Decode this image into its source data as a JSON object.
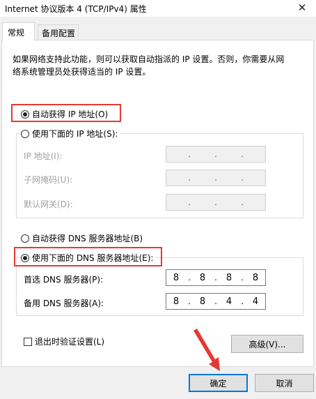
{
  "window": {
    "title": "Internet 协议版本 4 (TCP/IPv4) 属性",
    "close_icon": "close-icon"
  },
  "tabs": [
    {
      "label": "常规",
      "active": true
    },
    {
      "label": "备用配置",
      "active": false
    }
  ],
  "description": "如果网络支持此功能，则可以获取自动指派的 IP 设置。否则，你需要从网络系统管理员处获得适当的 IP 设置。",
  "ip_section": {
    "auto_label": "自动获得 IP 地址(O)",
    "auto_checked": true,
    "manual_label": "使用下面的 IP 地址(S):",
    "manual_checked": false,
    "fields": [
      {
        "label": "IP 地址(I):",
        "value": ". . ."
      },
      {
        "label": "子网掩码(U):",
        "value": ". . ."
      },
      {
        "label": "默认网关(D):",
        "value": ". . ."
      }
    ]
  },
  "dns_section": {
    "auto_label": "自动获得 DNS 服务器地址(B)",
    "auto_checked": false,
    "manual_label": "使用下面的 DNS 服务器地址(E):",
    "manual_checked": true,
    "preferred": {
      "label": "首选 DNS 服务器(P):",
      "octets": [
        "8",
        "8",
        "8",
        "8"
      ]
    },
    "alternate": {
      "label": "备用 DNS 服务器(A):",
      "octets": [
        "8",
        "8",
        "4",
        "4"
      ]
    }
  },
  "validate_label": "退出时验证设置(L)",
  "advanced_label": "高级(V)...",
  "ok_label": "确定",
  "cancel_label": "取消",
  "highlight_color": "#e53935"
}
